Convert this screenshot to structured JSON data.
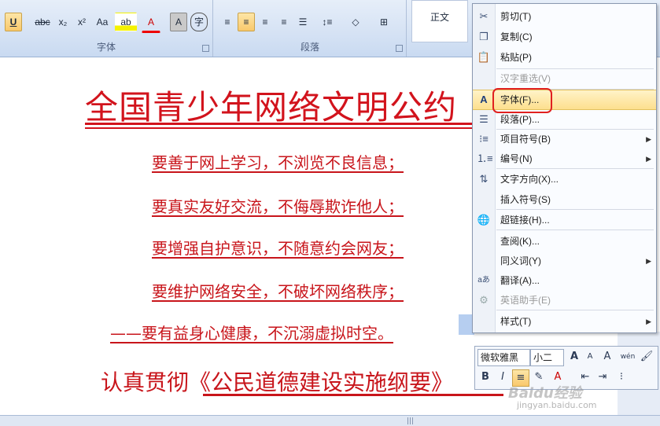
{
  "ribbon": {
    "font_group_label": "字体",
    "paragraph_group_label": "段落",
    "style_normal_label": "正文",
    "buttons": {
      "underline": "U",
      "strikethrough": "abc",
      "subscript": "x₂",
      "superscript": "x²",
      "change_case": "Aa",
      "highlight": "ab",
      "font_color": "A",
      "char_shading": "A",
      "enclose": "字"
    }
  },
  "document": {
    "title": "全国青少年网络文明公约",
    "lines": [
      "要善于网上学习，不浏览不良信息；",
      "要真实友好交流，不侮辱欺诈他人；",
      "要增强自护意识，不随意约会网友；",
      "要维护网络安全，不破坏网络秩序；",
      "——要有益身心健康，不沉溺虚拟时空。"
    ],
    "footer": "认真贯彻《公民道德建设实施纲要》"
  },
  "context_menu": {
    "items": [
      {
        "label": "剪切(T)",
        "icon": "scissors-icon",
        "disabled": false,
        "submenu": false
      },
      {
        "label": "复制(C)",
        "icon": "copy-icon",
        "disabled": false,
        "submenu": false
      },
      {
        "label": "粘贴(P)",
        "icon": "paste-icon",
        "disabled": false,
        "submenu": false
      },
      {
        "label": "汉字重选(V)",
        "icon": "",
        "disabled": true,
        "submenu": false
      },
      {
        "label": "字体(F)...",
        "icon": "font-icon",
        "disabled": false,
        "submenu": false
      },
      {
        "label": "段落(P)...",
        "icon": "paragraph-icon",
        "disabled": false,
        "submenu": false
      },
      {
        "label": "项目符号(B)",
        "icon": "bullets-icon",
        "disabled": false,
        "submenu": true
      },
      {
        "label": "编号(N)",
        "icon": "numbering-icon",
        "disabled": false,
        "submenu": true
      },
      {
        "label": "文字方向(X)...",
        "icon": "text-direction-icon",
        "disabled": false,
        "submenu": false
      },
      {
        "label": "插入符号(S)",
        "icon": "",
        "disabled": false,
        "submenu": false
      },
      {
        "label": "超链接(H)...",
        "icon": "hyperlink-icon",
        "disabled": false,
        "submenu": false
      },
      {
        "label": "查阅(K)...",
        "icon": "",
        "disabled": false,
        "submenu": false
      },
      {
        "label": "同义词(Y)",
        "icon": "",
        "disabled": false,
        "submenu": true
      },
      {
        "label": "翻译(A)...",
        "icon": "translate-icon",
        "disabled": false,
        "submenu": false
      },
      {
        "label": "英语助手(E)",
        "icon": "english-assistant-icon",
        "disabled": true,
        "submenu": false
      },
      {
        "label": "样式(T)",
        "icon": "",
        "disabled": false,
        "submenu": true
      }
    ]
  },
  "mini_toolbar": {
    "font_name": "微软雅黑",
    "font_size": "小二",
    "bold": "B",
    "italic": "I",
    "grow_font": "A",
    "shrink_font": "A",
    "phonetic": "wén"
  },
  "watermark": {
    "brand": "Baidu经验",
    "url": "jingyan.baidu.com"
  },
  "colors": {
    "accent_red": "#d2131c",
    "ribbon_blue": "#d5e2f4",
    "highlight_gold": "#fddf8e"
  }
}
